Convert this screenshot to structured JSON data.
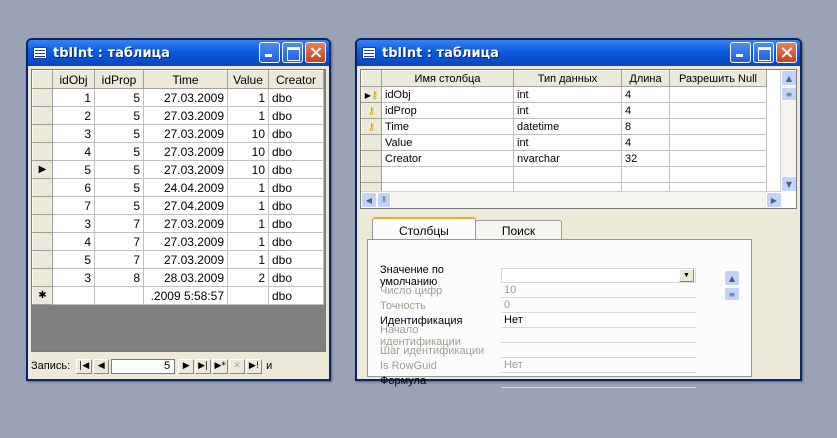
{
  "left_window": {
    "title": "tblInt : таблица",
    "columns": [
      "idObj",
      "idProp",
      "Time",
      "Value",
      "Creator"
    ],
    "rows": [
      [
        "1",
        "5",
        "27.03.2009",
        "1",
        "dbo"
      ],
      [
        "2",
        "5",
        "27.03.2009",
        "1",
        "dbo"
      ],
      [
        "3",
        "5",
        "27.03.2009",
        "10",
        "dbo"
      ],
      [
        "4",
        "5",
        "27.03.2009",
        "10",
        "dbo"
      ],
      [
        "5",
        "5",
        "27.03.2009",
        "10",
        "dbo"
      ],
      [
        "6",
        "5",
        "24.04.2009",
        "1",
        "dbo"
      ],
      [
        "7",
        "5",
        "27.04.2009",
        "1",
        "dbo"
      ],
      [
        "3",
        "7",
        "27.03.2009",
        "1",
        "dbo"
      ],
      [
        "4",
        "7",
        "27.03.2009",
        "1",
        "dbo"
      ],
      [
        "5",
        "7",
        "27.03.2009",
        "1",
        "dbo"
      ],
      [
        "3",
        "8",
        "28.03.2009",
        "2",
        "dbo"
      ]
    ],
    "new_row": [
      "",
      "",
      ".2009 5:58:57",
      "",
      "dbo"
    ],
    "current_row_index": 4,
    "record_label": "Запись:",
    "record_number": "5",
    "record_suffix": "и"
  },
  "right_window": {
    "title": "tblInt : таблица",
    "columns": [
      "Имя столбца",
      "Тип данных",
      "Длина",
      "Разрешить Null"
    ],
    "rows": [
      {
        "name": "idObj",
        "type": "int",
        "length": "4",
        "key": true
      },
      {
        "name": "idProp",
        "type": "int",
        "length": "4",
        "key": true
      },
      {
        "name": "Time",
        "type": "datetime",
        "length": "8",
        "key": true
      },
      {
        "name": "Value",
        "type": "int",
        "length": "4",
        "key": false
      },
      {
        "name": "Creator",
        "type": "nvarchar",
        "length": "32",
        "key": false
      }
    ],
    "tabs": [
      "Столбцы",
      "Поиск"
    ],
    "properties": [
      {
        "label": "Значение по умолчанию",
        "value": "",
        "dim": false
      },
      {
        "label": "Число цифр",
        "value": "10",
        "dim": true
      },
      {
        "label": "Точность",
        "value": "0",
        "dim": true
      },
      {
        "label": "Идентификация",
        "value": "Нет",
        "dim": false
      },
      {
        "label": "Начало идентификации",
        "value": "",
        "dim": true
      },
      {
        "label": "Шаг идентификации",
        "value": "",
        "dim": true
      },
      {
        "label": "Is RowGuid",
        "value": "Нет",
        "dim": true
      },
      {
        "label": "Формула",
        "value": "",
        "dim": false
      }
    ]
  }
}
